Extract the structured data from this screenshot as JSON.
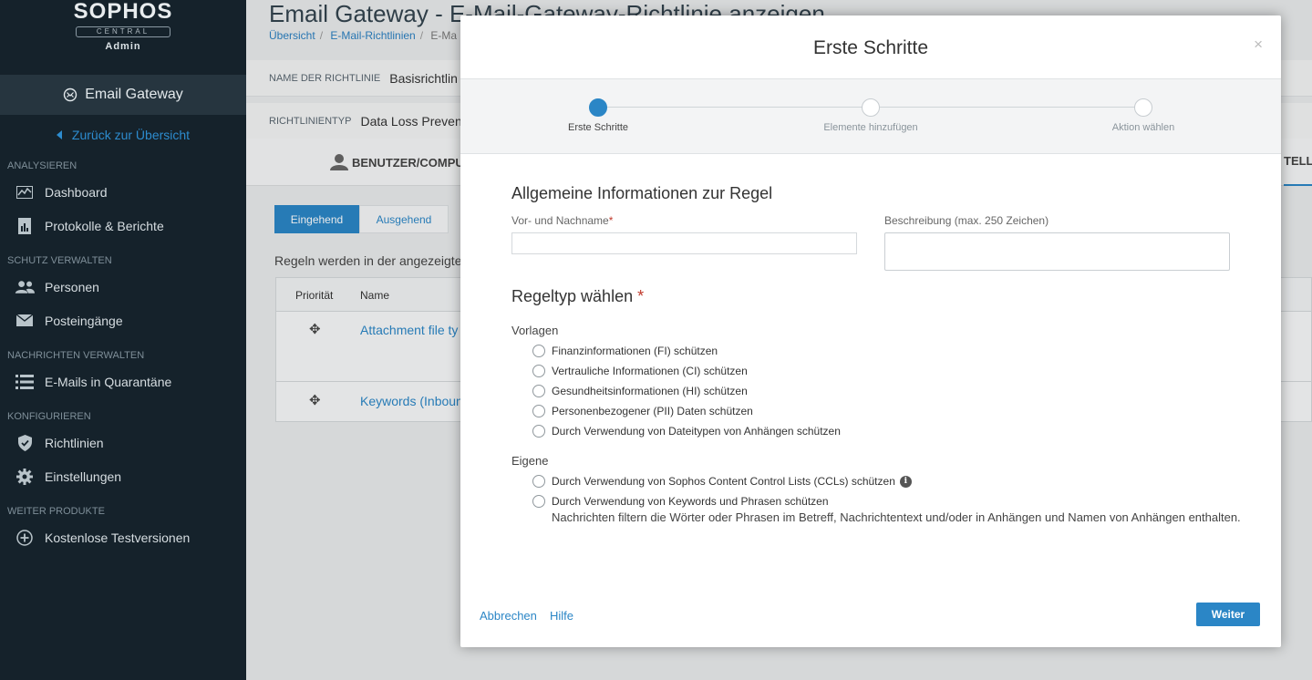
{
  "sidebar": {
    "brand": "SOPHOS",
    "brand_sub": "CENTRAL",
    "brand_role": "Admin",
    "product": "Email Gateway",
    "back_link": "Zurück zur Übersicht",
    "sections": [
      {
        "title": "ANALYSIEREN",
        "items": [
          {
            "label": "Dashboard",
            "icon": "chart-icon"
          },
          {
            "label": "Protokolle & Berichte",
            "icon": "report-icon"
          }
        ]
      },
      {
        "title": "SCHUTZ VERWALTEN",
        "items": [
          {
            "label": "Personen",
            "icon": "people-icon"
          },
          {
            "label": "Posteingänge",
            "icon": "envelope-icon"
          }
        ]
      },
      {
        "title": "NACHRICHTEN VERWALTEN",
        "items": [
          {
            "label": "E-Mails in Quarantäne",
            "icon": "list-icon"
          }
        ]
      },
      {
        "title": "KONFIGURIEREN",
        "items": [
          {
            "label": "Richtlinien",
            "icon": "shield-icon"
          },
          {
            "label": "Einstellungen",
            "icon": "gear-icon"
          }
        ]
      },
      {
        "title": "WEITER PRODUKTE",
        "items": [
          {
            "label": "Kostenlose Testversionen",
            "icon": "plus-circle-icon"
          }
        ]
      }
    ]
  },
  "page": {
    "title": "Email Gateway - E-Mail-Gateway-Richtlinie anzeigen",
    "breadcrumbs": [
      "Übersicht",
      "E-Mail-Richtlinien",
      "E-Ma"
    ],
    "policy_name_key": "NAME DER RICHTLINIE",
    "policy_name_value": "Basisrichtlin",
    "policy_type_key": "RICHTLINIENTYP",
    "policy_type_value": "Data Loss Preven",
    "tab_users": "BENUTZER/COMPU",
    "tab_settings": "TELLU",
    "inbound": "Eingehend",
    "outbound": "Ausgehend",
    "rules_note": "Regeln werden in der angezeigten",
    "table_headers": {
      "priority": "Priorität",
      "name": "Name"
    },
    "rules": [
      "Attachment file ty",
      "Keywords (Inboun"
    ]
  },
  "modal": {
    "title": "Erste Schritte",
    "close": "×",
    "steps": [
      "Erste Schritte",
      "Elemente hinzufügen",
      "Aktion wählen"
    ],
    "general_title": "Allgemeine Informationen zur Regel",
    "name_label": "Vor- und Nachname",
    "name_required": "*",
    "name_value": "",
    "desc_label": "Beschreibung (max. 250 Zeichen)",
    "desc_value": "",
    "ruletype_title": "Regeltyp wählen",
    "ruletype_required": "*",
    "templates_label": "Vorlagen",
    "templates": [
      "Finanzinformationen (FI) schützen",
      "Vertrauliche Informationen (CI) schützen",
      "Gesundheitsinformationen (HI) schützen",
      "Personenbezogener (PII) Daten schützen",
      "Durch Verwendung von Dateitypen von Anhängen schützen"
    ],
    "custom_label": "Eigene",
    "custom": [
      "Durch Verwendung von Sophos Content Control Lists (CCLs) schützen",
      "Durch Verwendung von Keywords und Phrasen schützen"
    ],
    "custom_hint": "Nachrichten filtern die Wörter oder Phrasen im Betreff, Nachrichtentext und/oder in Anhängen und Namen von Anhängen enthalten.",
    "cancel": "Abbrechen",
    "help": "Hilfe",
    "next": "Weiter"
  },
  "colors": {
    "accent": "#2b86c6",
    "sidebar_bg": "#15222b",
    "required": "#c0392b"
  }
}
